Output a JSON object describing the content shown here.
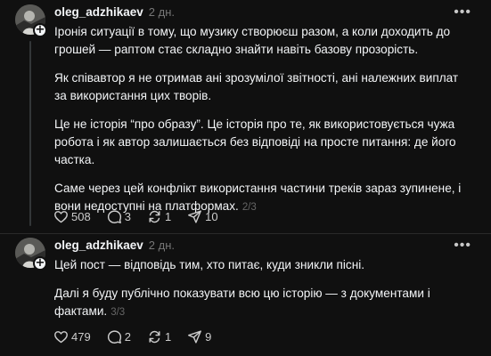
{
  "posts": [
    {
      "username": "oleg_adzhikaev",
      "time": "2 дн.",
      "paragraphs": [
        "Іронія ситуації в тому, що музику створюєш разом, а коли доходить до грошей — раптом стає складно знайти навіть базову прозорість.",
        "Як співавтор я не отримав ані зрозумілої звітності, ані належних виплат за використання цих творів.",
        "Це не історія “про образу”. Це історія про те, як використовується чужа робота і як автор залишається без відповіді на просте питання: де його частка.",
        "Саме через цей конфлікт використання частини треків зараз зупинене, і вони недоступні на платформах."
      ],
      "page": "2/3",
      "likes": "508",
      "comments": "3",
      "reposts": "1",
      "shares": "10"
    },
    {
      "username": "oleg_adzhikaev",
      "time": "2 дн.",
      "paragraphs": [
        "Цей пост — відповідь тим, хто питає, куди зникли пісні.",
        "Далі я буду публічно показувати всю цю історію — з документами і фактами."
      ],
      "page": "3/3",
      "likes": "479",
      "comments": "2",
      "reposts": "1",
      "shares": "9"
    }
  ],
  "icons": {
    "plus": "+",
    "more": "•••"
  },
  "colors": {
    "background": "#101010",
    "text": "#f3f5f7",
    "muted": "#777777"
  }
}
